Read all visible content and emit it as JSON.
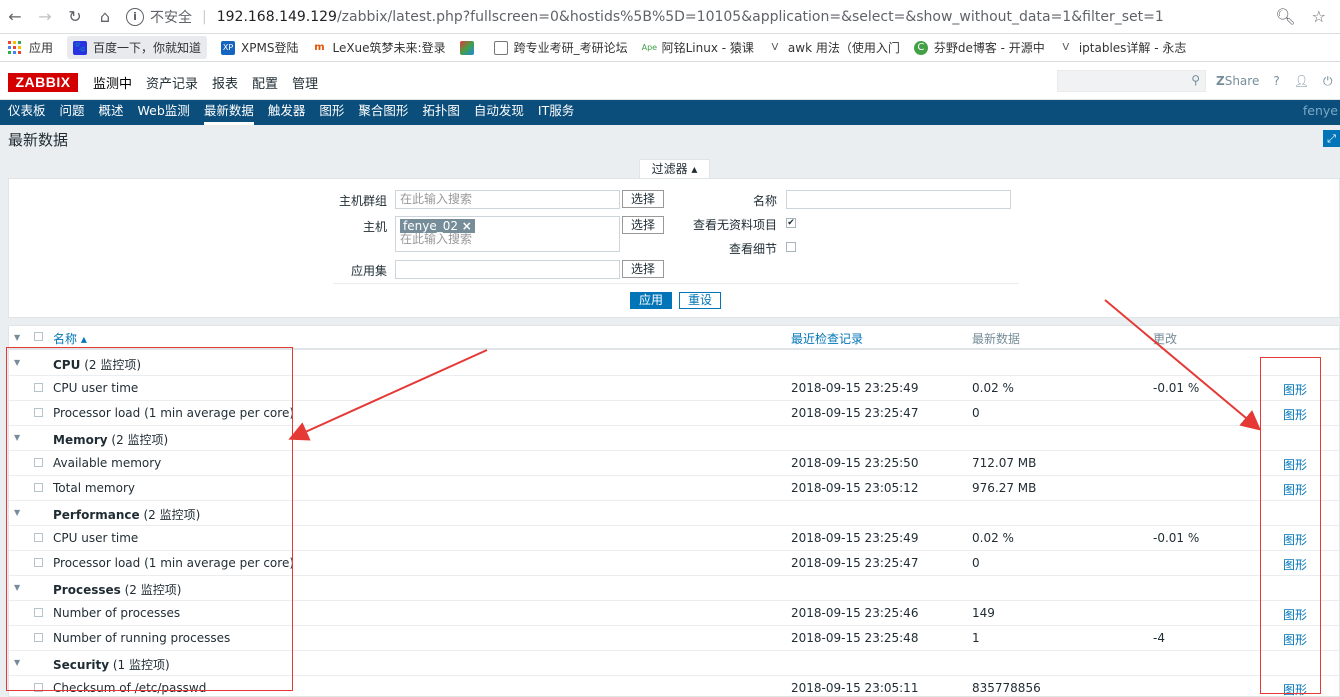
{
  "browser": {
    "insecure_label": "不安全",
    "url_host": "192.168.149.129",
    "url_rest": "/zabbix/latest.php?fullscreen=0&hostids%5B%5D=10105&application=&select=&show_without_data=1&filter_set=1",
    "bookmarks": [
      {
        "label": "应用",
        "icon": "apps-grid-icon"
      },
      {
        "label": "百度一下，你就知道",
        "icon": "baidu-icon"
      },
      {
        "label": "XPMS登陆",
        "icon": "xp-icon"
      },
      {
        "label": "LeXue筑梦未来:登录",
        "icon": "lexue-icon"
      },
      {
        "label": "",
        "icon": "colorful-icon"
      },
      {
        "label": "跨专业考研_考研论坛",
        "icon": "page-icon"
      },
      {
        "label": "阿铭Linux - 猿课",
        "icon": "ape-icon"
      },
      {
        "label": "awk 用法（使用入门",
        "icon": "vuetify-icon"
      },
      {
        "label": "芬野de博客 - 开源中",
        "icon": "green-c-icon"
      },
      {
        "label": "iptables详解 - 永志",
        "icon": "vuetify-icon"
      }
    ]
  },
  "header": {
    "logo": "ZABBIX",
    "top_menu": [
      "监测中",
      "资产记录",
      "报表",
      "配置",
      "管理"
    ],
    "share": "Share",
    "help": "?",
    "sub_menu": [
      "仪表板",
      "问题",
      "概述",
      "Web监测",
      "最新数据",
      "触发器",
      "图形",
      "聚合图形",
      "拓扑图",
      "自动发现",
      "IT服务"
    ],
    "sub_active": "最新数据",
    "user": "fenye"
  },
  "page": {
    "title": "最新数据"
  },
  "filter": {
    "tab_label": "过滤器 ▴",
    "host_group_label": "主机群组",
    "host_group_placeholder": "在此输入搜索",
    "host_label": "主机",
    "host_tag": "fenye_02",
    "host_placeholder": "在此输入搜索",
    "app_label": "应用集",
    "select_label": "选择",
    "name_label": "名称",
    "show_without_data_label": "查看无资料项目",
    "show_details_label": "查看细节",
    "apply_label": "应用",
    "reset_label": "重设"
  },
  "table": {
    "headers": {
      "name": "名称 ▴",
      "last_check": "最近检查记录",
      "last_value": "最新数据",
      "change": "更改"
    },
    "graph_label": "图形",
    "rows": [
      {
        "type": "app",
        "name": "CPU",
        "count": "(2 监控项)"
      },
      {
        "type": "item",
        "name": "CPU user time",
        "last_check": "2018-09-15 23:25:49",
        "value": "0.02 %",
        "change": "-0.01 %"
      },
      {
        "type": "item",
        "name": "Processor load (1 min average per core)",
        "last_check": "2018-09-15 23:25:47",
        "value": "0",
        "change": ""
      },
      {
        "type": "app",
        "name": "Memory",
        "count": "(2 监控项)"
      },
      {
        "type": "item",
        "name": "Available memory",
        "last_check": "2018-09-15 23:25:50",
        "value": "712.07 MB",
        "change": ""
      },
      {
        "type": "item",
        "name": "Total memory",
        "last_check": "2018-09-15 23:05:12",
        "value": "976.27 MB",
        "change": ""
      },
      {
        "type": "app",
        "name": "Performance",
        "count": "(2 监控项)"
      },
      {
        "type": "item",
        "name": "CPU user time",
        "last_check": "2018-09-15 23:25:49",
        "value": "0.02 %",
        "change": "-0.01 %"
      },
      {
        "type": "item",
        "name": "Processor load (1 min average per core)",
        "last_check": "2018-09-15 23:25:47",
        "value": "0",
        "change": ""
      },
      {
        "type": "app",
        "name": "Processes",
        "count": "(2 监控项)"
      },
      {
        "type": "item",
        "name": "Number of processes",
        "last_check": "2018-09-15 23:25:46",
        "value": "149",
        "change": ""
      },
      {
        "type": "item",
        "name": "Number of running processes",
        "last_check": "2018-09-15 23:25:48",
        "value": "1",
        "change": "-4"
      },
      {
        "type": "app",
        "name": "Security",
        "count": "(1 监控项)"
      },
      {
        "type": "item",
        "name": "Checksum of /etc/passwd",
        "last_check": "2018-09-15 23:05:11",
        "value": "835778856",
        "change": ""
      }
    ]
  },
  "colors": {
    "brand_red": "#d40000",
    "nav_blue": "#0b4d7b",
    "link_blue": "#0275b8",
    "annotation_red": "#e53935"
  }
}
